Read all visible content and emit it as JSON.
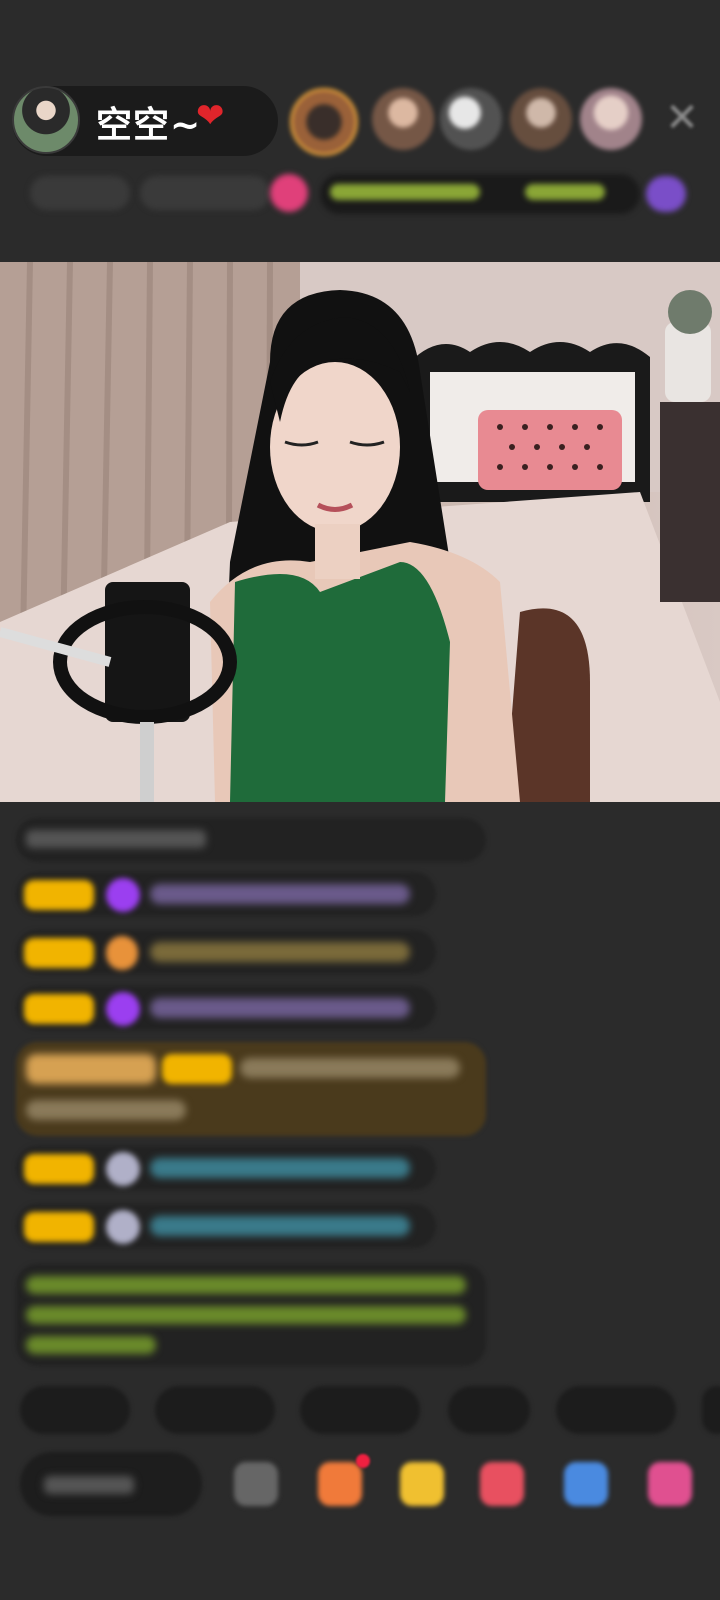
{
  "host": {
    "name": "空空~",
    "heart": "❤"
  },
  "header": {
    "close_icon": "✕",
    "viewer_count": 5
  },
  "colors": {
    "background": "#2b2b2b",
    "pill": "#1b1b1b",
    "heart": "#e0252b",
    "gold_badge": "#f1b400",
    "purple_gem": "#9b3ff0",
    "highlight_banner": "#4a3a1c",
    "green_text": "#9bd13a"
  },
  "chat": {
    "message_count": 9
  },
  "bottom": {
    "quick_replies_count": 6,
    "tools": [
      "emoji-icon",
      "gift-icon",
      "crown-gift-icon",
      "heart-gift-icon",
      "game-icon",
      "grid-icon"
    ]
  }
}
